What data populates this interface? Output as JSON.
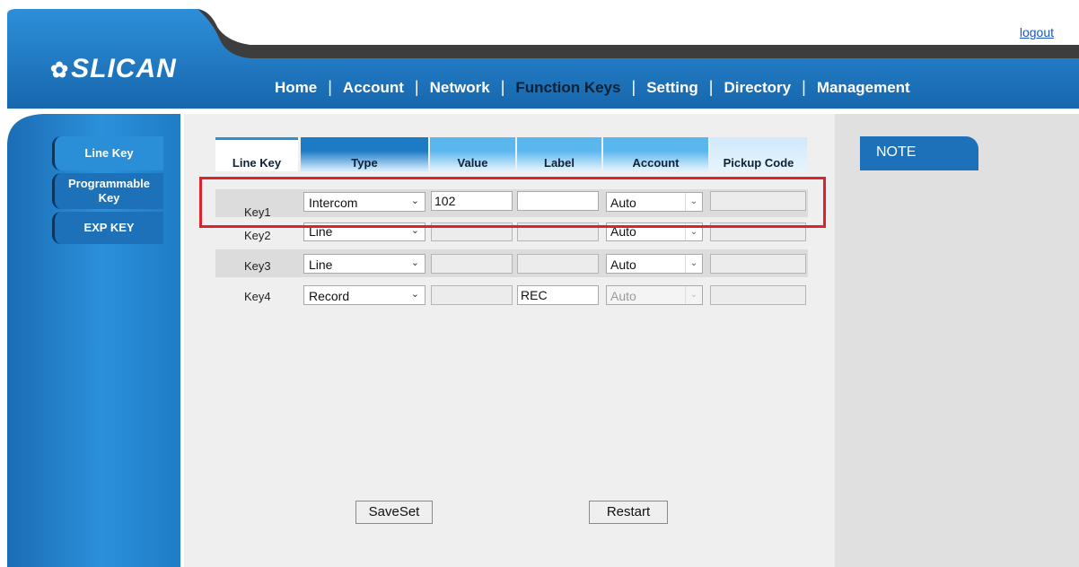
{
  "header": {
    "logout_label": "logout",
    "logo_text": "SLICAN",
    "nav": [
      "Home",
      "Account",
      "Network",
      "Function Keys",
      "Setting",
      "Directory",
      "Management"
    ],
    "nav_separator": "|",
    "active_nav": "Function Keys"
  },
  "sidebar": {
    "items": [
      {
        "label": "Line Key",
        "active": true
      },
      {
        "label": "Programmable Key",
        "active": false
      },
      {
        "label": "EXP KEY",
        "active": false
      }
    ]
  },
  "table": {
    "columns": [
      "Line Key",
      "Type",
      "Value",
      "Label",
      "Account",
      "Pickup Code"
    ],
    "rows": [
      {
        "key": "Key1",
        "type": "Intercom",
        "value": "102",
        "label": "",
        "account": "Auto",
        "pickup_code": ""
      },
      {
        "key": "Key2",
        "type": "Line",
        "value": "",
        "label": "",
        "account": "Auto",
        "pickup_code": ""
      },
      {
        "key": "Key3",
        "type": "Line",
        "value": "",
        "label": "",
        "account": "Auto",
        "pickup_code": ""
      },
      {
        "key": "Key4",
        "type": "Record",
        "value": "",
        "label": "REC",
        "account": "Auto",
        "pickup_code": ""
      }
    ]
  },
  "buttons": {
    "saveset": "SaveSet",
    "restart": "Restart"
  },
  "note": {
    "title": "NOTE"
  },
  "colors": {
    "brand_blue": "#1d71b8",
    "header_dark": "#3d3d3d",
    "highlight_red": "#d9232d"
  }
}
